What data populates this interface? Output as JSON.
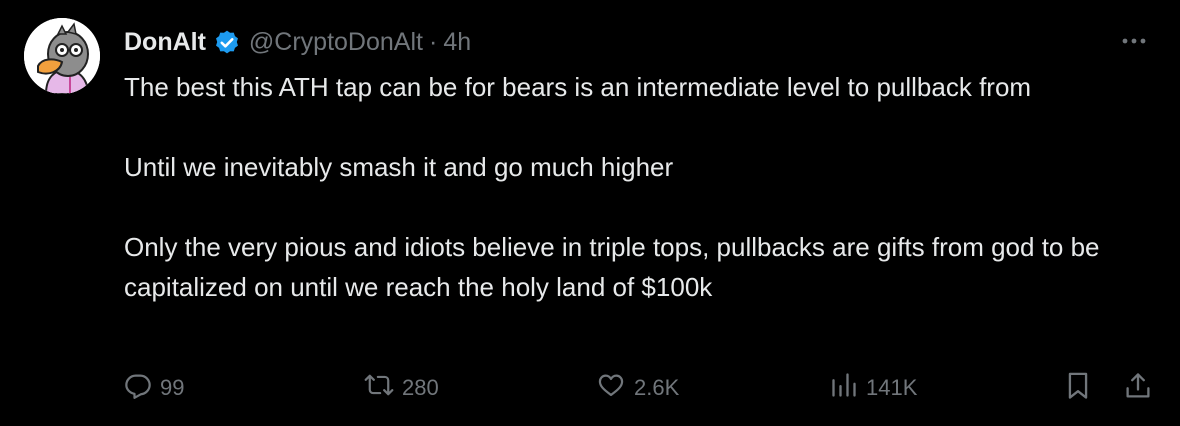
{
  "tweet": {
    "author_name": "DonAlt",
    "handle": "@CryptoDonAlt",
    "separator": "·",
    "time": "4h",
    "paragraphs": [
      "The best this ATH tap can be for bears is an intermediate level to pullback from",
      "Until we inevitably smash it and go much higher",
      "Only the very pious and idiots believe in triple tops, pullbacks are gifts from god to be capitalized on until we reach the holy land of $100k"
    ],
    "stats": {
      "replies": "99",
      "reposts": "280",
      "likes": "2.6K",
      "views": "141K"
    }
  },
  "icons": {
    "verified": "verified-badge-icon",
    "more": "more-icon",
    "reply": "reply-icon",
    "repost": "repost-icon",
    "like": "heart-icon",
    "views": "views-icon",
    "bookmark": "bookmark-icon",
    "share": "share-icon"
  },
  "colors": {
    "background": "#000000",
    "text": "#e7e9ea",
    "muted": "#71767b",
    "verified": "#1d9bf0"
  }
}
